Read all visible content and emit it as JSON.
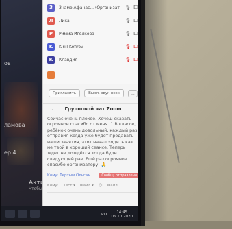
{
  "participants": [
    {
      "initial": "З",
      "color": "#5b5fc7",
      "name": "Знамо Афанас... (Организатор, я)",
      "mic": "muted-gray",
      "video": "off"
    },
    {
      "initial": "Л",
      "color": "#e05a4f",
      "name": "Лика",
      "mic": "on",
      "video": "off"
    },
    {
      "initial": "Р",
      "color": "#e05a4f",
      "name": "Римма Иголкова",
      "mic": "on",
      "video": "off"
    },
    {
      "initial": "K",
      "color": "#4a5bd4",
      "name": "Kirill Kofirov",
      "mic": "off",
      "video": "off"
    },
    {
      "initial": "К",
      "color": "#3d3fa0",
      "name": "Клавдия",
      "mic": "off",
      "video": "off"
    },
    {
      "initial": "",
      "color": "#e57c3a",
      "name": "",
      "mic": "",
      "video": ""
    }
  ],
  "actions": {
    "invite": "Пригласить",
    "mute_all": "Выкл. звук всех",
    "more": "..."
  },
  "chat": {
    "title": "Групповой чат Zoom",
    "collapse_icon": "chevron-down-icon",
    "message": "Сейчас очень плохое. Хочеш сказать огромное спасибо от меня. 1 В классе, ребёнок очень довольный, каждый раз отправил когда уже будет продавать наши занятия, этот начал ходить как не твой в хороший сеансе. Теперь ждет не дождётся когда будет следующий раз. Ещё раз огромное спасибо организатору! 🙏"
  },
  "recipient": {
    "to": "Кому: Тертым Ольгам…",
    "badge": "Сообщ. отправлено"
  },
  "input_tools": [
    "Кому:",
    "Тест ▾",
    "Файл ▾",
    "☺",
    "Файл"
  ],
  "background": {
    "left_labels": [
      "ов",
      "ламова",
      "ер 4"
    ],
    "activation_title": "Акти",
    "activation_sub": "Чтобы а… перейди…"
  },
  "taskbar": {
    "time": "14:45",
    "date": "06.10.2020",
    "lang": "РУС"
  },
  "colors": {
    "chat_bg": "#f4f4f4",
    "accent_blue": "#5a7bd6",
    "mute_red": "#d33"
  }
}
